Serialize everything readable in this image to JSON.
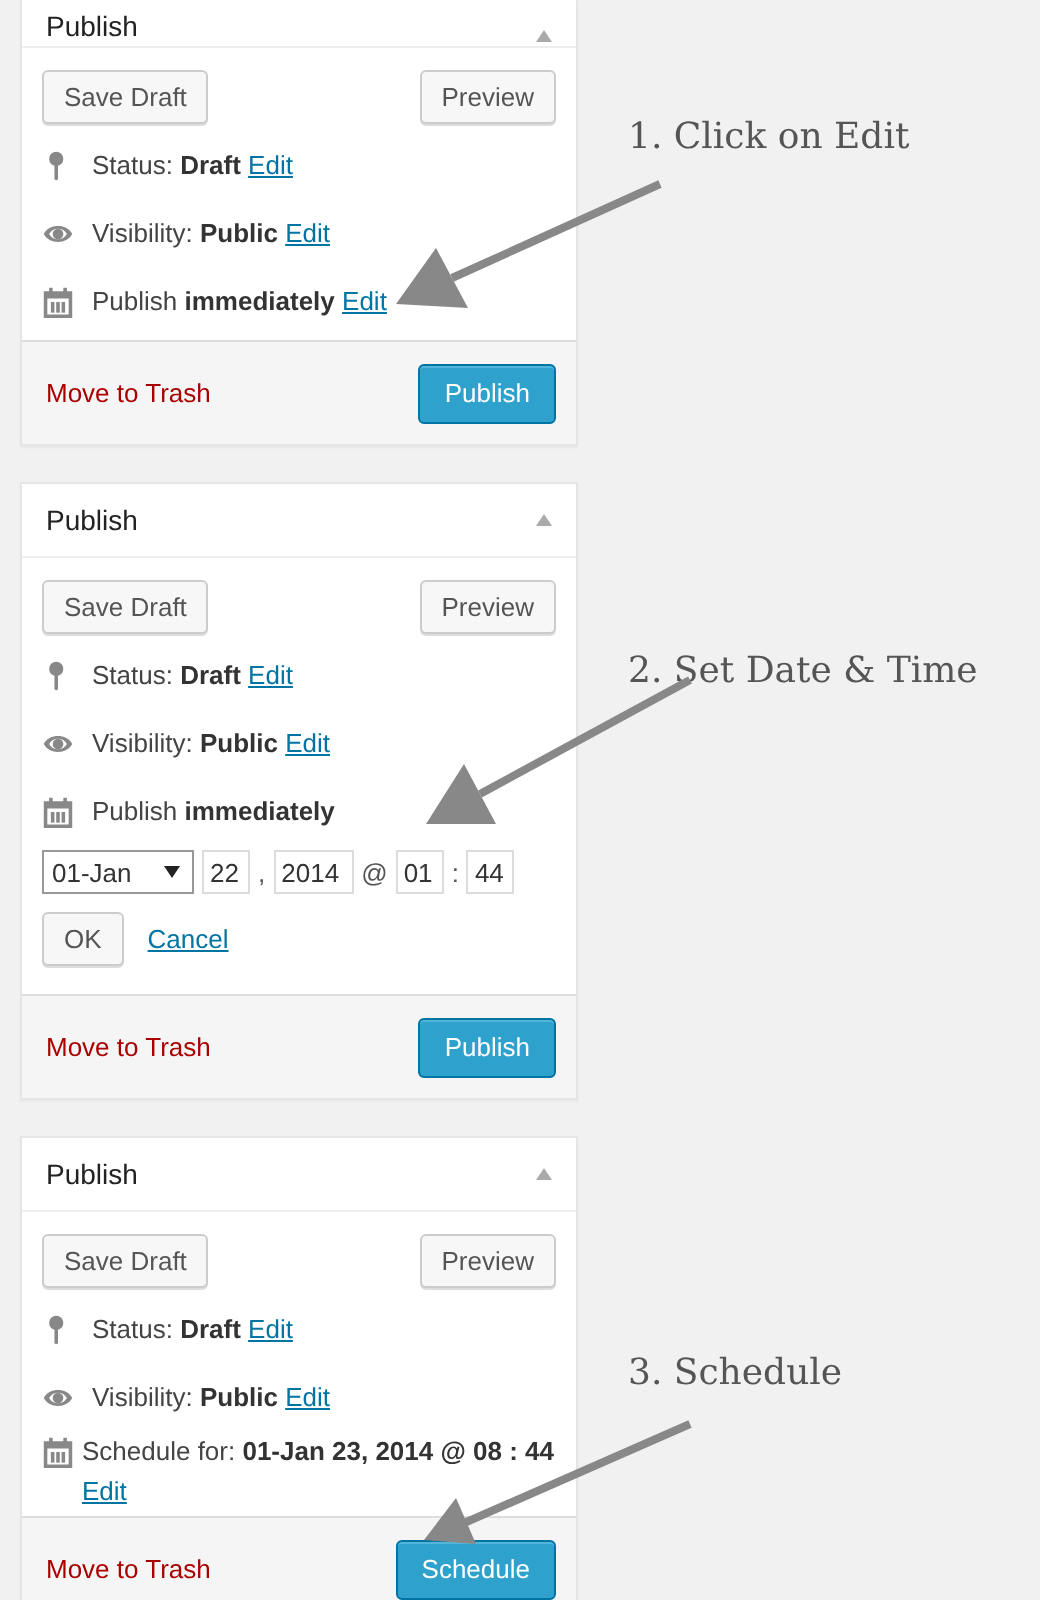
{
  "panels": [
    {
      "title": "Publish",
      "save_draft": "Save Draft",
      "preview": "Preview",
      "rows": [
        {
          "kind": "status",
          "text": "Status: **Draft**",
          "link": "Edit"
        },
        {
          "kind": "visibility",
          "text": "Visibility: **Public**",
          "link": "Edit"
        },
        {
          "kind": "schedule",
          "text": "Publish **immediately**",
          "link": "Edit"
        }
      ],
      "trash": "Move to Trash",
      "primary": "Publish"
    },
    {
      "title": "Publish",
      "save_draft": "Save Draft",
      "preview": "Preview",
      "rows": [
        {
          "kind": "status",
          "text": "Status: **Draft**",
          "link": "Edit"
        },
        {
          "kind": "visibility",
          "text": "Visibility: **Public**",
          "link": "Edit"
        },
        {
          "kind": "schedule",
          "text": "Publish **immediately**"
        }
      ],
      "date_editor": {
        "month": "01-Jan",
        "day": "22",
        "sep_day": ",",
        "year": "2014",
        "sep_at": "@",
        "hour": "01",
        "sep_time": ":",
        "minute": "44",
        "ok": "OK",
        "cancel": "Cancel"
      },
      "trash": "Move to Trash",
      "primary": "Publish"
    },
    {
      "title": "Publish",
      "save_draft": "Save Draft",
      "preview": "Preview",
      "rows": [
        {
          "kind": "status",
          "text": "Status: **Draft**",
          "link": "Edit"
        },
        {
          "kind": "visibility",
          "text": "Visibility: **Public**",
          "link": "Edit"
        },
        {
          "kind": "schedule",
          "text": "Schedule for: **01-Jan 23, 2014 @ 08 : 44**",
          "link": "Edit"
        }
      ],
      "trash": "Move to Trash",
      "primary": "Schedule"
    }
  ],
  "annotations": [
    {
      "text": "1. Click on Edit"
    },
    {
      "text": "2. Set Date & Time"
    },
    {
      "text": "3. Schedule"
    }
  ]
}
